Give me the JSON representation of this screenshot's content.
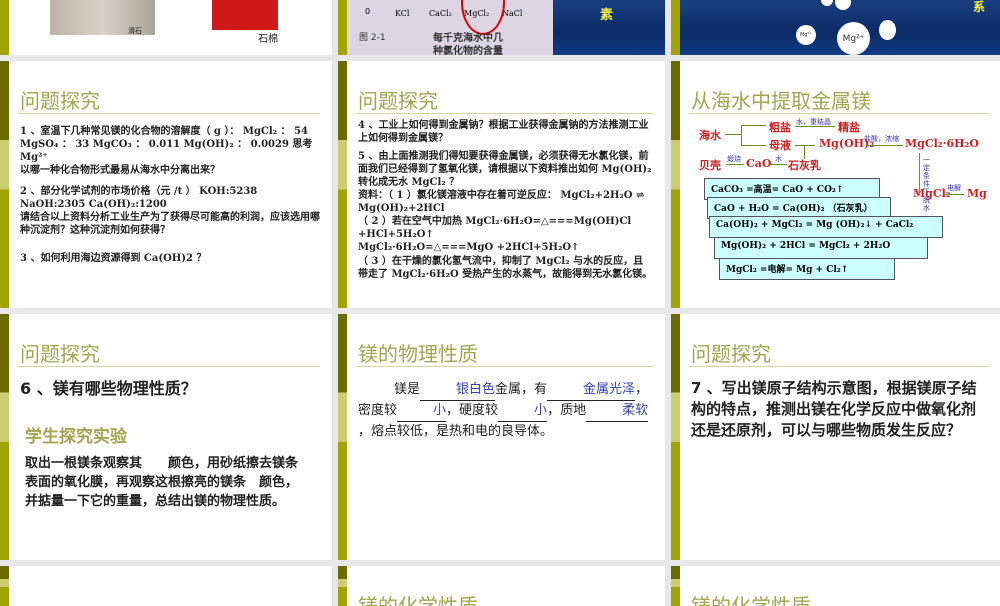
{
  "row1": {
    "slide_a": {
      "caption_talc": "滑石",
      "caption_asbestos": "石棉"
    },
    "slide_b": {
      "axis_zero": "0",
      "chart_labels": [
        "KCl",
        "CaCl₂",
        "MgCl₂",
        "NaCl"
      ],
      "figure_caption_1": "图 2-1",
      "figure_caption_2": "每千克海水中几",
      "figure_caption_3": "种氯化物的含量",
      "side_text": "素"
    },
    "slide_c": {
      "bubble_small": "Mg²⁺",
      "bubble_big": "Mg²⁺",
      "side_text": "系"
    }
  },
  "slide_q1": {
    "title": "问题探究",
    "p1_l1": "1 、室温下几种常见镁的化合物的溶解度（ g ）： MgCl₂ ： 54",
    "p1_l2": "MgSO₄ ： 33  MgCO₃ ： 0.011  Mg(OH)₂ ： 0.0029  思考 Mg²⁺",
    "p1_l3": "以哪一种化合物形式最易从海水中分离出来？",
    "p2_l1": "2 、部分化学试剂的市场价格（元 /t ） KOH:5238",
    "p2_l2": "NaOH:2305  Ca(OH)₂:1200",
    "p2_l3": "请结合以上资料分析工业生产为了获得尽可能高的利润，应该选用哪种沉淀剂？这种沉淀剂如何获得？",
    "p3": "3 、如何利用海边资源得到 Ca(OH)2 ？"
  },
  "slide_q2": {
    "title": "问题探究",
    "p4": "4 、工业上如何得到金属钠？根据工业获得金属钠的方法推测工业上如何得到金属镁？",
    "p5": "5 、由上面推测我们得知要获得金属镁，必须获得无水氯化镁，前面我们已经得到了氢氧化镁，请根据以下资料推出如何 Mg(OH)₂ 转化成无水 MgCl₂ ？",
    "m1": "资料：（ 1 ）氯化镁溶液中存在着可逆反应： MgCl₂+2H₂O ⇌ Mg(OH)₂+2HCl",
    "m2": "（ 2 ）若在空气中加热 MgCl₂·6H₂O=△===Mg(OH)Cl +HCl+5H₂O↑",
    "m3": "MgCl₂·6H₂O=△===MgO +2HCl+5H₂O↑",
    "m4": "（ 3 ）在干燥的氯化氢气流中，抑制了 MgCl₂ 与水的反应，且带走了 MgCl₂·6H₂O 受热产生的水蒸气，故能得到无水氯化镁。"
  },
  "slide_extract": {
    "title": "从海水中提取金属镁",
    "seawater": "海水",
    "crude_salt": "粗盐",
    "refined_salt": "精盐",
    "mother_liquor": "母液",
    "mgoh2": "Mg(OH)₂",
    "mgcl2_hydrate": "MgCl₂·6H₂O",
    "shell": "贝壳",
    "cao": "CaO",
    "lime_milk": "石灰乳",
    "mgcl2": "MgCl₂",
    "mg": "Mg",
    "lbl_recryst": "水，重结晶",
    "lbl_hcl": "盐酸，浓缩",
    "lbl_calcine": "煅烧",
    "lbl_water": "水",
    "lbl_dehydrate": "一定条件下 脱水",
    "lbl_electrolysis": "电解",
    "equations": [
      "CaCO₃ =高温= CaO + CO₂↑",
      "CaO + H₂O = Ca(OH)₂ （石灰乳）",
      "Ca(OH)₂ + MgCl₂ = Mg (OH)₂↓ + CaCl₂",
      "Mg(OH)₂ + 2HCl = MgCl₂ + 2H₂O",
      "MgCl₂ =电解= Mg + Cl₂↑"
    ]
  },
  "slide_q6": {
    "title": "问题探究",
    "question": "6 、镁有哪些物理性质？",
    "subtitle": "学生探究实验",
    "text": "取出一根镁条观察其　　颜色，用砂纸擦去镁条表面的氧化膜，再观察这根擦亮的镁条　颜色，并掂量一下它的重量，总结出镁的物理性质。"
  },
  "slide_phys": {
    "title": "镁的物理性质",
    "t1": "镁是",
    "a1": "银白色",
    "t2": "金属，有",
    "a2": "金属光泽",
    "t3": "，密度较",
    "a3": "小",
    "t4": "，硬度较",
    "a4": "小",
    "t5": "，质地",
    "a5": "柔软",
    "t6": "，熔点较低，是热和电的良导体。"
  },
  "slide_q7": {
    "title": "问题探究",
    "question": "7 、写出镁原子结构示意图，根据镁原子结构的特点，推测出镁在化学反应中做氧化剂还是还原剂，可以与哪些物质发生反应？"
  },
  "row4": {
    "title_b": "镁的化学性质",
    "title_c": "镁的化学性质"
  }
}
